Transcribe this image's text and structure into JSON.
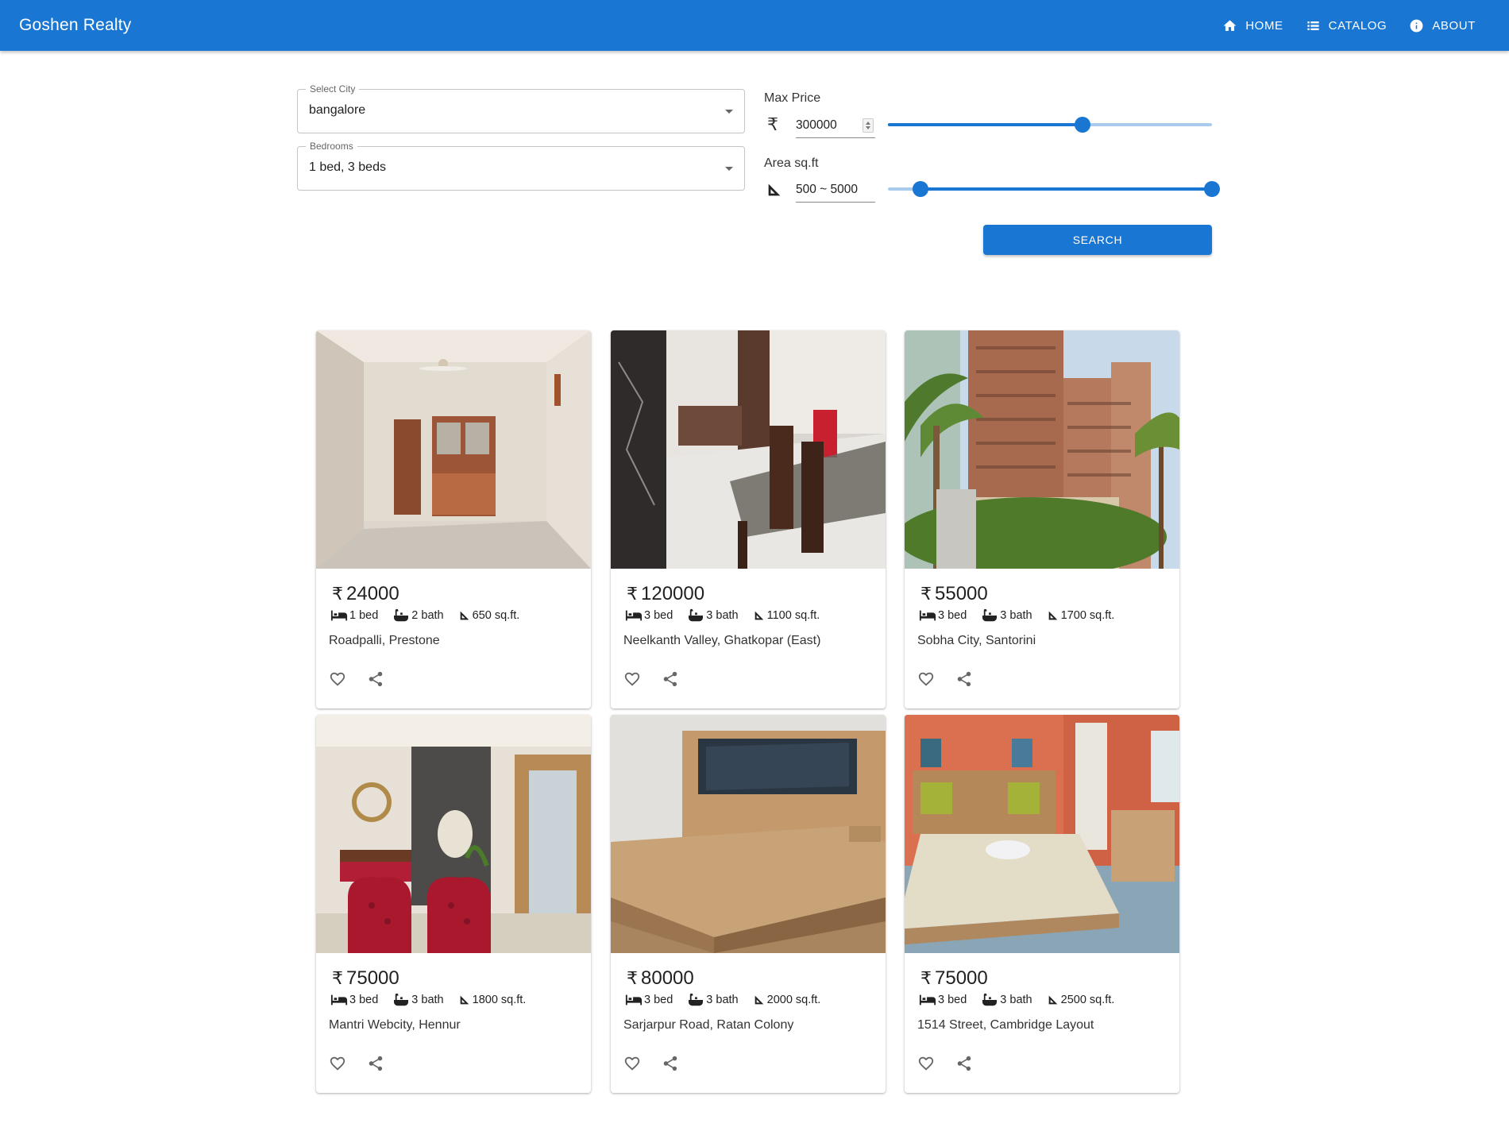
{
  "appbar": {
    "brand": "Goshen Realty",
    "nav": [
      {
        "label": "HOME",
        "icon": "home-icon"
      },
      {
        "label": "CATALOG",
        "icon": "list-icon"
      },
      {
        "label": "ABOUT",
        "icon": "info-icon"
      }
    ],
    "color": "#1976d2"
  },
  "filters": {
    "city": {
      "legend": "Select City",
      "value": "bangalore"
    },
    "bedrooms": {
      "legend": "Bedrooms",
      "value": "1 bed, 3 beds"
    },
    "max_price": {
      "label": "Max Price",
      "currency_symbol": "₹",
      "value": "300000",
      "slider_fraction": 0.6
    },
    "area": {
      "label": "Area sq.ft",
      "value": "500 ~ 5000",
      "range_start_fraction": 0.1,
      "range_end_fraction": 1.0
    },
    "search_label": "SEARCH"
  },
  "listings": [
    {
      "currency": "₹",
      "price": "24000",
      "bed": "1 bed",
      "bath": "2 bath",
      "area": "650 sq.ft.",
      "address": "Roadpalli, Prestone"
    },
    {
      "currency": "₹",
      "price": "120000",
      "bed": "3 bed",
      "bath": "3 bath",
      "area": "1100 sq.ft.",
      "address": "Neelkanth Valley, Ghatkopar (East)"
    },
    {
      "currency": "₹",
      "price": "55000",
      "bed": "3 bed",
      "bath": "3 bath",
      "area": "1700 sq.ft.",
      "address": "Sobha City, Santorini"
    },
    {
      "currency": "₹",
      "price": "75000",
      "bed": "3 bed",
      "bath": "3 bath",
      "area": "1800 sq.ft.",
      "address": "Mantri Webcity, Hennur"
    },
    {
      "currency": "₹",
      "price": "80000",
      "bed": "3 bed",
      "bath": "3 bath",
      "area": "2000 sq.ft.",
      "address": "Sarjarpur Road, Ratan Colony"
    },
    {
      "currency": "₹",
      "price": "75000",
      "bed": "3 bed",
      "bath": "3 bath",
      "area": "2500 sq.ft.",
      "address": "1514 Street, Cambridge Layout"
    }
  ]
}
